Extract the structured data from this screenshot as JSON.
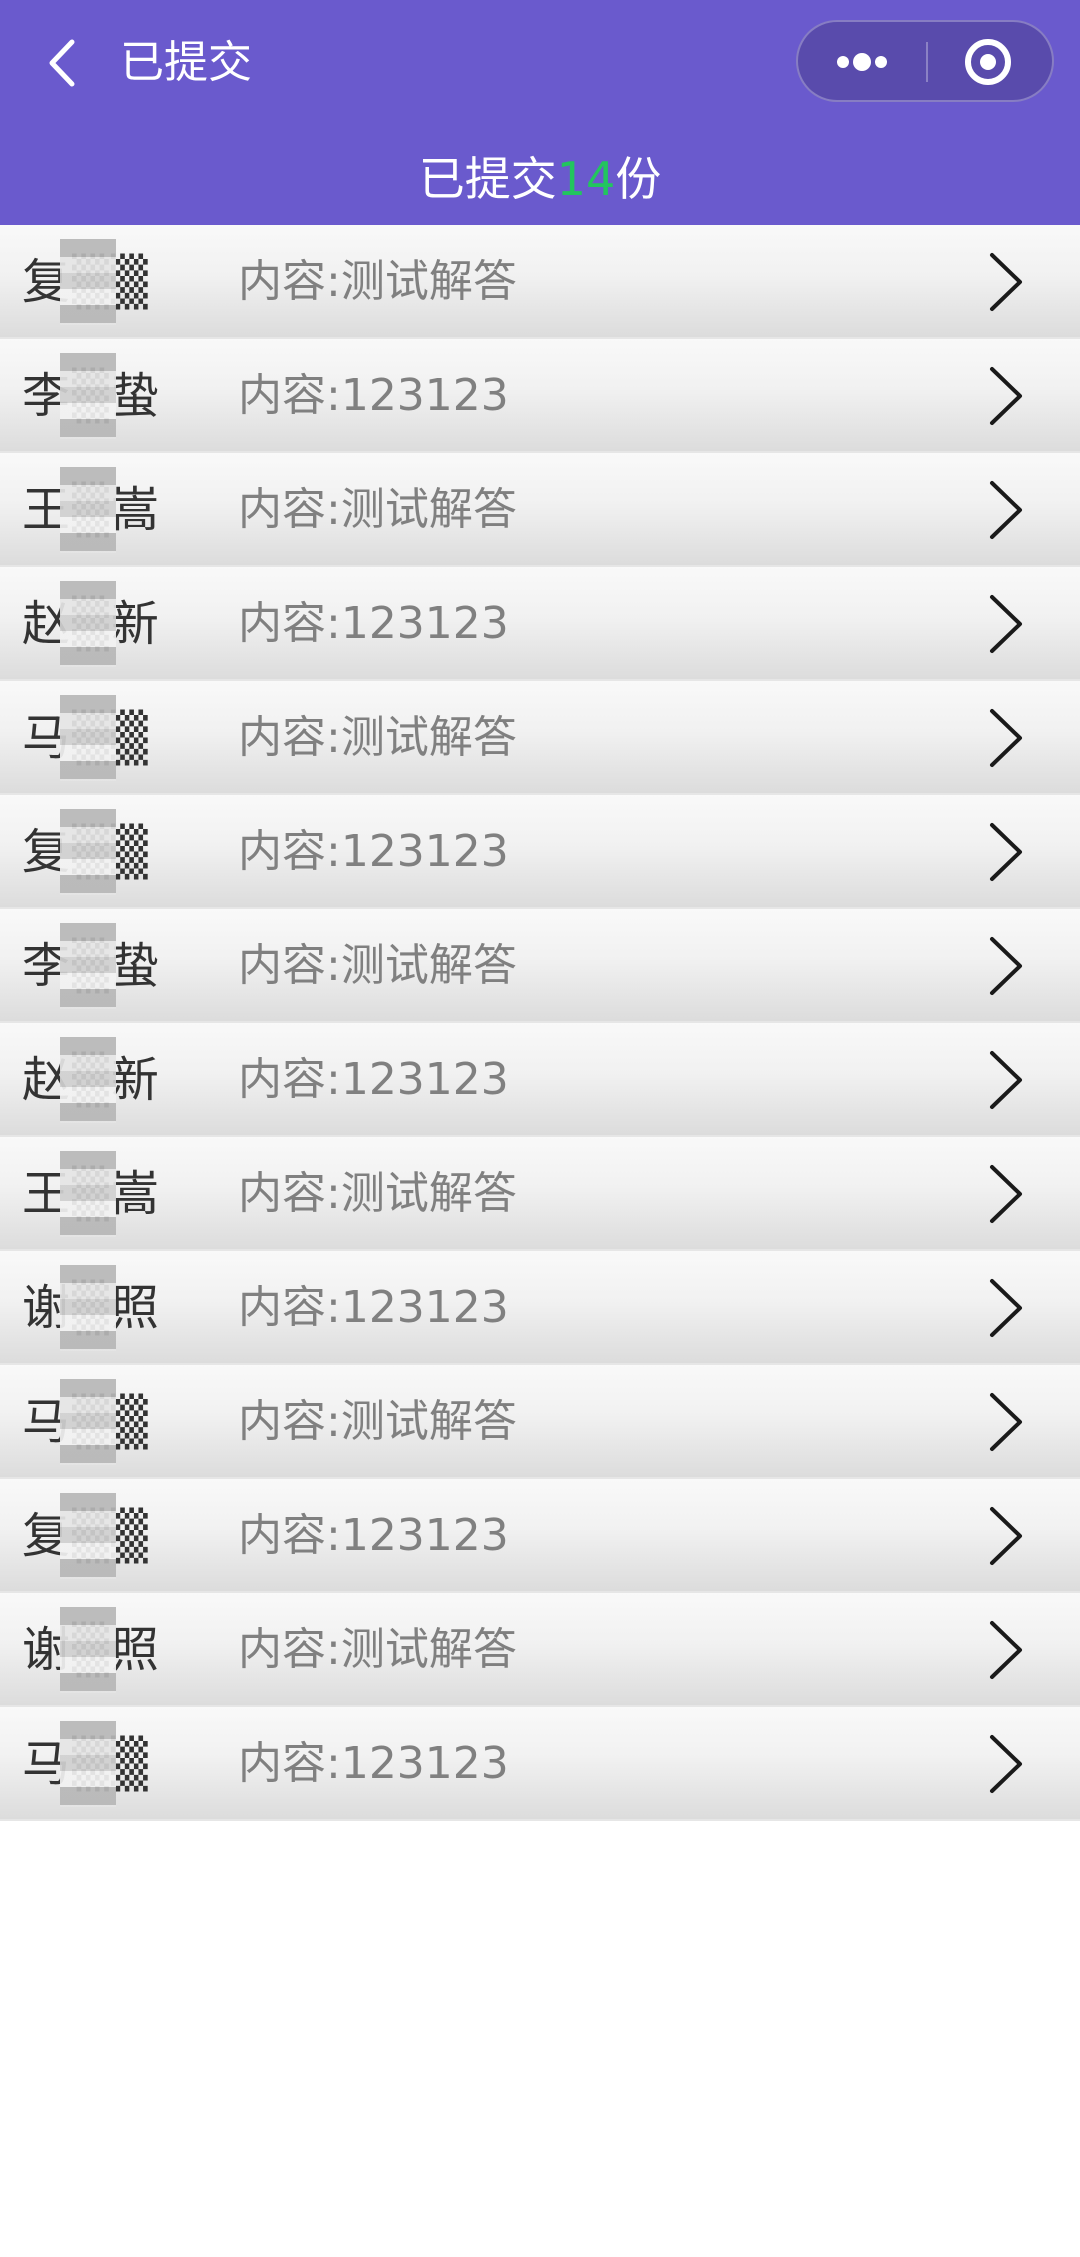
{
  "nav": {
    "title": "已提交",
    "back_icon": "chevron-left-icon",
    "more_icon": "more-dots-icon",
    "close_icon": "target-circle-icon"
  },
  "summary": {
    "prefix": "已提交",
    "count": "14",
    "suffix": "份"
  },
  "colors": {
    "header": "#6a5acd",
    "count": "#22c55e",
    "content_text": "#808080"
  },
  "submissions": [
    {
      "name": "复▒▒",
      "content": "内容:测试解答"
    },
    {
      "name": "李▒蛰",
      "content": "内容:123123"
    },
    {
      "name": "王▒嵩",
      "content": "内容:测试解答"
    },
    {
      "name": "赵▒新",
      "content": "内容:123123"
    },
    {
      "name": "马▒▒",
      "content": "内容:测试解答"
    },
    {
      "name": "复▒▒",
      "content": "内容:123123"
    },
    {
      "name": "李▒蛰",
      "content": "内容:测试解答"
    },
    {
      "name": "赵▒新",
      "content": "内容:123123"
    },
    {
      "name": "王▒嵩",
      "content": "内容:测试解答"
    },
    {
      "name": "谢▒照",
      "content": "内容:123123"
    },
    {
      "name": "马▒▒",
      "content": "内容:测试解答"
    },
    {
      "name": "复▒▒",
      "content": "内容:123123"
    },
    {
      "name": "谢▒照",
      "content": "内容:测试解答"
    },
    {
      "name": "马▒▒",
      "content": "内容:123123"
    }
  ]
}
